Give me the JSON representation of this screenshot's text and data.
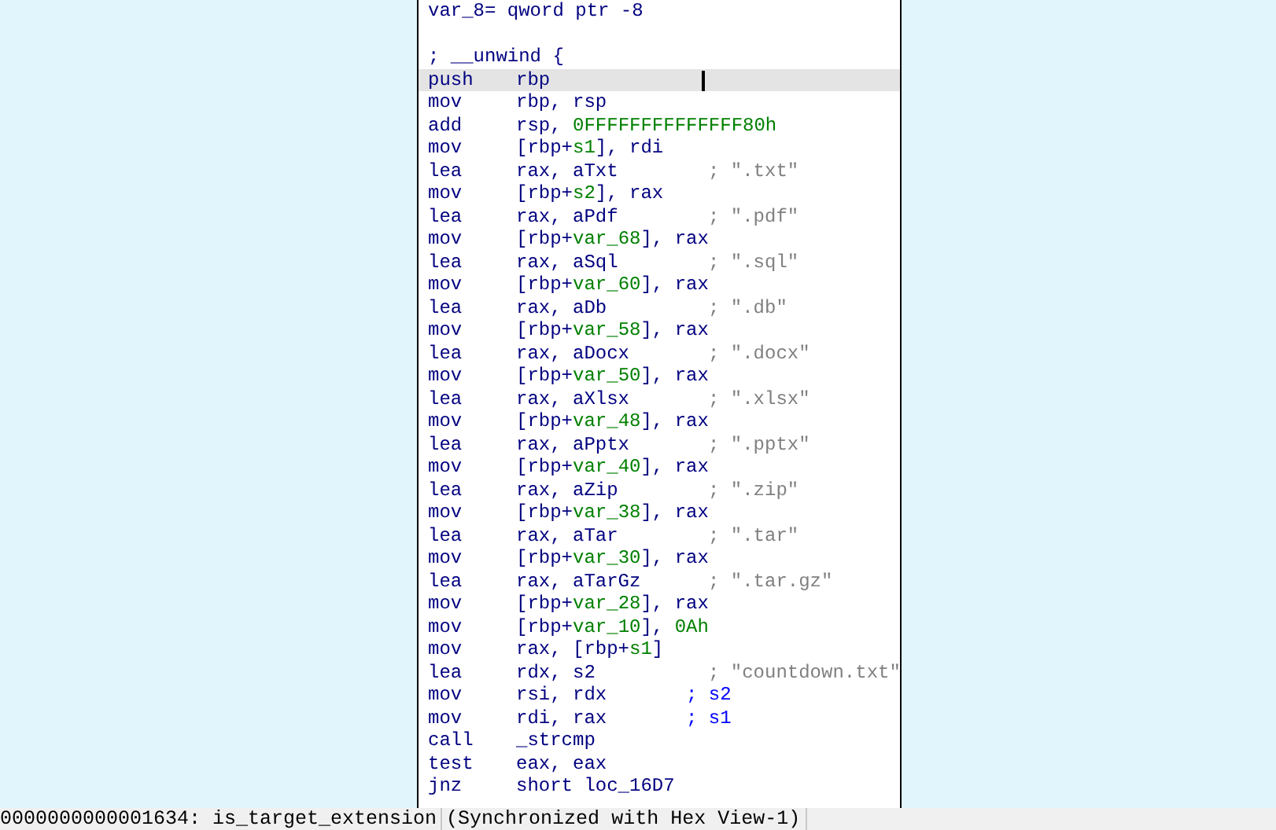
{
  "node": {
    "lines": [
      {
        "kind": "label",
        "selected": false,
        "segments": [
          {
            "text": "var_8= qword ptr -8",
            "kind": "plain"
          }
        ]
      },
      {
        "kind": "blank",
        "selected": false
      },
      {
        "kind": "label",
        "selected": false,
        "segments": [
          {
            "text": "; __unwind {",
            "kind": "plain"
          }
        ]
      },
      {
        "kind": "insn",
        "selected": true,
        "mnemonic": "push",
        "segments": [
          {
            "text": "rbp",
            "kind": "plain"
          }
        ]
      },
      {
        "kind": "insn",
        "selected": false,
        "mnemonic": "mov",
        "segments": [
          {
            "text": "rbp, rsp",
            "kind": "plain"
          }
        ]
      },
      {
        "kind": "insn",
        "selected": false,
        "mnemonic": "add",
        "segments": [
          {
            "text": "rsp, ",
            "kind": "plain"
          },
          {
            "text": "0FFFFFFFFFFFFFF80h",
            "kind": "num"
          }
        ]
      },
      {
        "kind": "insn",
        "selected": false,
        "mnemonic": "mov",
        "segments": [
          {
            "text": "[rbp+",
            "kind": "plain"
          },
          {
            "text": "s1",
            "kind": "var"
          },
          {
            "text": "], rdi",
            "kind": "plain"
          }
        ]
      },
      {
        "kind": "insn",
        "selected": false,
        "mnemonic": "lea",
        "segments": [
          {
            "text": "rax, aTxt",
            "kind": "plain"
          }
        ],
        "comment": {
          "text": "; \".txt\"",
          "kind": "string"
        }
      },
      {
        "kind": "insn",
        "selected": false,
        "mnemonic": "mov",
        "segments": [
          {
            "text": "[rbp+",
            "kind": "plain"
          },
          {
            "text": "s2",
            "kind": "var"
          },
          {
            "text": "], rax",
            "kind": "plain"
          }
        ]
      },
      {
        "kind": "insn",
        "selected": false,
        "mnemonic": "lea",
        "segments": [
          {
            "text": "rax, aPdf",
            "kind": "plain"
          }
        ],
        "comment": {
          "text": "; \".pdf\"",
          "kind": "string"
        }
      },
      {
        "kind": "insn",
        "selected": false,
        "mnemonic": "mov",
        "segments": [
          {
            "text": "[rbp+",
            "kind": "plain"
          },
          {
            "text": "var_68",
            "kind": "var"
          },
          {
            "text": "], rax",
            "kind": "plain"
          }
        ]
      },
      {
        "kind": "insn",
        "selected": false,
        "mnemonic": "lea",
        "segments": [
          {
            "text": "rax, aSql",
            "kind": "plain"
          }
        ],
        "comment": {
          "text": "; \".sql\"",
          "kind": "string"
        }
      },
      {
        "kind": "insn",
        "selected": false,
        "mnemonic": "mov",
        "segments": [
          {
            "text": "[rbp+",
            "kind": "plain"
          },
          {
            "text": "var_60",
            "kind": "var"
          },
          {
            "text": "], rax",
            "kind": "plain"
          }
        ]
      },
      {
        "kind": "insn",
        "selected": false,
        "mnemonic": "lea",
        "segments": [
          {
            "text": "rax, aDb",
            "kind": "plain"
          }
        ],
        "comment": {
          "text": "; \".db\"",
          "kind": "string"
        }
      },
      {
        "kind": "insn",
        "selected": false,
        "mnemonic": "mov",
        "segments": [
          {
            "text": "[rbp+",
            "kind": "plain"
          },
          {
            "text": "var_58",
            "kind": "var"
          },
          {
            "text": "], rax",
            "kind": "plain"
          }
        ]
      },
      {
        "kind": "insn",
        "selected": false,
        "mnemonic": "lea",
        "segments": [
          {
            "text": "rax, aDocx",
            "kind": "plain"
          }
        ],
        "comment": {
          "text": "; \".docx\"",
          "kind": "string"
        }
      },
      {
        "kind": "insn",
        "selected": false,
        "mnemonic": "mov",
        "segments": [
          {
            "text": "[rbp+",
            "kind": "plain"
          },
          {
            "text": "var_50",
            "kind": "var"
          },
          {
            "text": "], rax",
            "kind": "plain"
          }
        ]
      },
      {
        "kind": "insn",
        "selected": false,
        "mnemonic": "lea",
        "segments": [
          {
            "text": "rax, aXlsx",
            "kind": "plain"
          }
        ],
        "comment": {
          "text": "; \".xlsx\"",
          "kind": "string"
        }
      },
      {
        "kind": "insn",
        "selected": false,
        "mnemonic": "mov",
        "segments": [
          {
            "text": "[rbp+",
            "kind": "plain"
          },
          {
            "text": "var_48",
            "kind": "var"
          },
          {
            "text": "], rax",
            "kind": "plain"
          }
        ]
      },
      {
        "kind": "insn",
        "selected": false,
        "mnemonic": "lea",
        "segments": [
          {
            "text": "rax, aPptx",
            "kind": "plain"
          }
        ],
        "comment": {
          "text": "; \".pptx\"",
          "kind": "string"
        }
      },
      {
        "kind": "insn",
        "selected": false,
        "mnemonic": "mov",
        "segments": [
          {
            "text": "[rbp+",
            "kind": "plain"
          },
          {
            "text": "var_40",
            "kind": "var"
          },
          {
            "text": "], rax",
            "kind": "plain"
          }
        ]
      },
      {
        "kind": "insn",
        "selected": false,
        "mnemonic": "lea",
        "segments": [
          {
            "text": "rax, aZip",
            "kind": "plain"
          }
        ],
        "comment": {
          "text": "; \".zip\"",
          "kind": "string"
        }
      },
      {
        "kind": "insn",
        "selected": false,
        "mnemonic": "mov",
        "segments": [
          {
            "text": "[rbp+",
            "kind": "plain"
          },
          {
            "text": "var_38",
            "kind": "var"
          },
          {
            "text": "], rax",
            "kind": "plain"
          }
        ]
      },
      {
        "kind": "insn",
        "selected": false,
        "mnemonic": "lea",
        "segments": [
          {
            "text": "rax, aTar",
            "kind": "plain"
          }
        ],
        "comment": {
          "text": "; \".tar\"",
          "kind": "string"
        }
      },
      {
        "kind": "insn",
        "selected": false,
        "mnemonic": "mov",
        "segments": [
          {
            "text": "[rbp+",
            "kind": "plain"
          },
          {
            "text": "var_30",
            "kind": "var"
          },
          {
            "text": "], rax",
            "kind": "plain"
          }
        ]
      },
      {
        "kind": "insn",
        "selected": false,
        "mnemonic": "lea",
        "segments": [
          {
            "text": "rax, aTarGz",
            "kind": "plain"
          }
        ],
        "comment": {
          "text": "; \".tar.gz\"",
          "kind": "string"
        }
      },
      {
        "kind": "insn",
        "selected": false,
        "mnemonic": "mov",
        "segments": [
          {
            "text": "[rbp+",
            "kind": "plain"
          },
          {
            "text": "var_28",
            "kind": "var"
          },
          {
            "text": "], rax",
            "kind": "plain"
          }
        ]
      },
      {
        "kind": "insn",
        "selected": false,
        "mnemonic": "mov",
        "segments": [
          {
            "text": "[rbp+",
            "kind": "plain"
          },
          {
            "text": "var_10",
            "kind": "var"
          },
          {
            "text": "], ",
            "kind": "plain"
          },
          {
            "text": "0Ah",
            "kind": "num"
          }
        ]
      },
      {
        "kind": "insn",
        "selected": false,
        "mnemonic": "mov",
        "segments": [
          {
            "text": "rax, [rbp+",
            "kind": "plain"
          },
          {
            "text": "s1",
            "kind": "var"
          },
          {
            "text": "]",
            "kind": "plain"
          }
        ]
      },
      {
        "kind": "insn",
        "selected": false,
        "mnemonic": "lea",
        "segments": [
          {
            "text": "rdx, s2",
            "kind": "plain"
          }
        ],
        "comment": {
          "text": "; \"countdown.txt\"",
          "kind": "string"
        }
      },
      {
        "kind": "insn",
        "selected": false,
        "mnemonic": "mov",
        "segments": [
          {
            "text": "rsi, rdx",
            "kind": "plain"
          }
        ],
        "comment": {
          "text": "; s2",
          "kind": "ref"
        }
      },
      {
        "kind": "insn",
        "selected": false,
        "mnemonic": "mov",
        "segments": [
          {
            "text": "rdi, rax",
            "kind": "plain"
          }
        ],
        "comment": {
          "text": "; s1",
          "kind": "ref"
        }
      },
      {
        "kind": "insn",
        "selected": false,
        "mnemonic": "call",
        "segments": [
          {
            "text": "_strcmp",
            "kind": "name"
          }
        ]
      },
      {
        "kind": "insn",
        "selected": false,
        "mnemonic": "test",
        "segments": [
          {
            "text": "eax, eax",
            "kind": "plain"
          }
        ]
      },
      {
        "kind": "insn",
        "selected": false,
        "mnemonic": "jnz",
        "segments": [
          {
            "text": "short loc_16D7",
            "kind": "plain"
          }
        ]
      }
    ]
  },
  "status_bar": {
    "location": "0000000000001634: is_target_extension",
    "sync": "(Synchronized with Hex View-1)"
  }
}
